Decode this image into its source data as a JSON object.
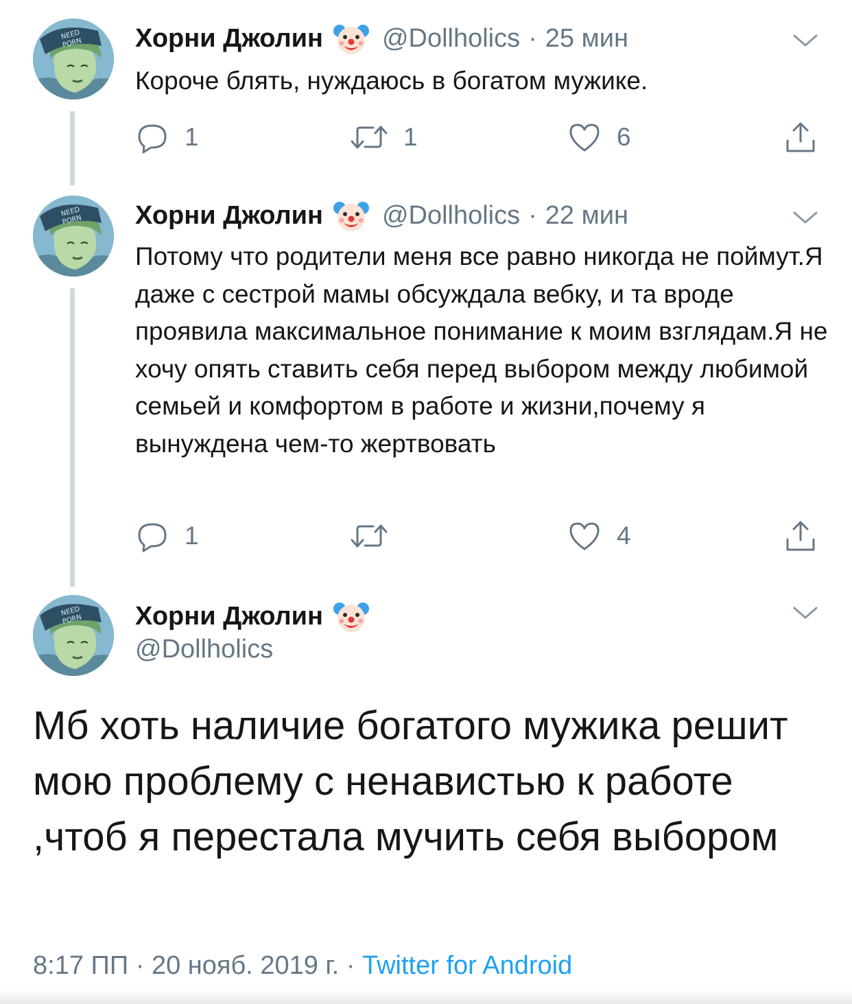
{
  "colors": {
    "text": "#14171a",
    "secondary": "#657786",
    "link": "#1da1f2",
    "thread_line": "#cfd9de"
  },
  "tweets": [
    {
      "name": "Хорни Джолин",
      "handle": "@Dollholics",
      "dot": "·",
      "time": "25 мин",
      "text": "Короче блять, нуждаюсь в богатом мужике.",
      "reply_count": "1",
      "retweet_count": "1",
      "like_count": "6"
    },
    {
      "name": "Хорни Джолин",
      "handle": "@Dollholics",
      "dot": "·",
      "time": "22 мин",
      "text": "Потому что родители меня все равно никогда не поймут.Я даже с сестрой мамы обсуждала вебку, и та вроде проявила максимальное понимание к моим взглядам.Я не хочу опять ставить себя перед выбором между любимой семьей и комфортом в работе и жизни,почему я вынуждена чем-то жертвовать",
      "reply_count": "1",
      "retweet_count": "",
      "like_count": "4"
    }
  ],
  "main_tweet": {
    "name": "Хорни Джолин",
    "handle": "@Dollholics",
    "text": "Мб хоть наличие богатого мужика решит мою проблему с ненавистью к работе ,чтоб я перестала мучить себя выбором",
    "time": "8:17 ПП",
    "dot": "·",
    "date": "20 нояб. 2019 г.",
    "source": "Twitter for Android"
  },
  "icons": {
    "avatar": "avatar-image",
    "name_emoji": "clown-face-icon",
    "menu": "chevron-down-icon",
    "reply": "reply-icon",
    "retweet": "retweet-icon",
    "like": "heart-icon",
    "share": "share-icon"
  }
}
